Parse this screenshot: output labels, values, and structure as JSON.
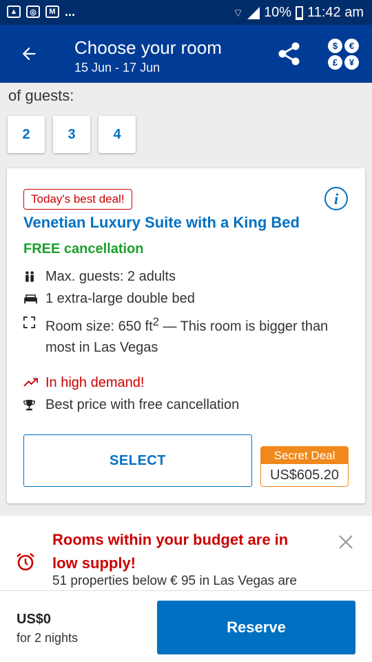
{
  "status_bar": {
    "icons": [
      "image-icon",
      "instagram-icon",
      "gmail-icon"
    ],
    "more": "...",
    "battery": "10%",
    "time": "11:42 am"
  },
  "app_bar": {
    "title": "Choose your room",
    "dates": "15 Jun - 17 Jun",
    "currency_symbols": [
      "$",
      "€",
      "£",
      "¥"
    ]
  },
  "guests": {
    "label": "of guests:",
    "options": [
      "2",
      "3",
      "4"
    ]
  },
  "room": {
    "badge": "Today's best deal!",
    "name": "Venetian Luxury Suite with a King Bed",
    "cancellation": "FREE cancellation",
    "features": {
      "max_guests": "Max. guests: 2 adults",
      "bed": "1 extra-large double bed",
      "size_prefix": "Room size: 650 ft",
      "size_sup": "2",
      "size_suffix": " — This room is bigger than most in Las Vegas",
      "demand": "In high demand!",
      "best_price": "Best price with free cancellation"
    },
    "select_label": "SELECT",
    "deal_label": "Secret Deal",
    "price": "US$605.20"
  },
  "alert": {
    "title": "Rooms within your budget are in low supply!",
    "subtitle": "51 properties below € 95 in Las Vegas are"
  },
  "bottom_bar": {
    "total": "US$0",
    "nights": "for 2 nights",
    "reserve_label": "Reserve"
  },
  "colors": {
    "brand_dark": "#003b95",
    "accent_blue": "#0071c2",
    "deal_red": "#cc0000",
    "free_green": "#1aa12a",
    "secret_orange": "#f0891b"
  }
}
